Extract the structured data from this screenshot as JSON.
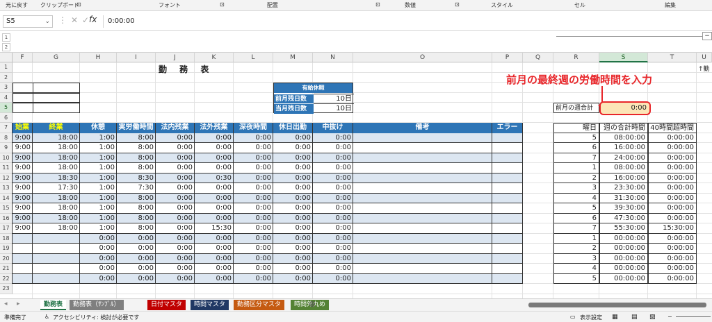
{
  "ribbon": {
    "groups": [
      "元に戻す",
      "クリップボード",
      "フォント",
      "配置",
      "数値",
      "スタイル",
      "セル",
      "編集"
    ],
    "launcher_icon": "dialog-launcher-icon"
  },
  "formula_bar": {
    "name_box": "S5",
    "formula": "0:00:00",
    "fx_label": "fx"
  },
  "outline_levels": [
    "1",
    "2"
  ],
  "columns": [
    "F",
    "G",
    "H",
    "I",
    "J",
    "K",
    "L",
    "M",
    "N",
    "O",
    "P",
    "Q",
    "R",
    "S",
    "T",
    "U"
  ],
  "selected_column": "S",
  "rows": [
    "1",
    "2",
    "3",
    "4",
    "5",
    "6",
    "7",
    "8",
    "9",
    "10",
    "11",
    "12",
    "13",
    "14",
    "15",
    "16",
    "17",
    "18",
    "19",
    "20",
    "21",
    "22",
    "23"
  ],
  "selected_row": "5",
  "title": "勤 務 表",
  "note_right": "↑勤",
  "paid_leave": {
    "title": "有給休暇",
    "rows": [
      {
        "label": "前月残日数",
        "value": "10日"
      },
      {
        "label": "当月残日数",
        "value": "10日"
      }
    ]
  },
  "annotation": "前月の最終週の労働時間を入力",
  "prev_week_label": "前月の週合計",
  "prev_week_value": "0:00",
  "table_headers": [
    "始業",
    "終業",
    "休憩",
    "実労働時間",
    "法内残業",
    "法外残業",
    "深夜時間",
    "休日出勤",
    "中抜け",
    "備考",
    "エラー"
  ],
  "table_rows": [
    [
      "9:00",
      "18:00",
      "1:00",
      "8:00",
      "0:00",
      "0:00",
      "0:00",
      "0:00",
      "0:00"
    ],
    [
      "9:00",
      "18:00",
      "1:00",
      "8:00",
      "0:00",
      "0:00",
      "0:00",
      "0:00",
      "0:00"
    ],
    [
      "9:00",
      "18:00",
      "1:00",
      "8:00",
      "0:00",
      "0:00",
      "0:00",
      "0:00",
      "0:00"
    ],
    [
      "9:00",
      "18:00",
      "1:00",
      "8:00",
      "0:00",
      "0:00",
      "0:00",
      "0:00",
      "0:00"
    ],
    [
      "9:00",
      "18:30",
      "1:00",
      "8:30",
      "0:00",
      "0:30",
      "0:00",
      "0:00",
      "0:00"
    ],
    [
      "9:00",
      "17:30",
      "1:00",
      "7:30",
      "0:00",
      "0:00",
      "0:00",
      "0:00",
      "0:00"
    ],
    [
      "9:00",
      "18:00",
      "1:00",
      "8:00",
      "0:00",
      "0:00",
      "0:00",
      "0:00",
      "0:00"
    ],
    [
      "9:00",
      "18:00",
      "1:00",
      "8:00",
      "0:00",
      "0:00",
      "0:00",
      "0:00",
      "0:00"
    ],
    [
      "9:00",
      "18:00",
      "1:00",
      "8:00",
      "0:00",
      "0:00",
      "0:00",
      "0:00",
      "0:00"
    ],
    [
      "9:00",
      "18:00",
      "1:00",
      "8:00",
      "0:00",
      "15:30",
      "0:00",
      "0:00",
      "0:00"
    ],
    [
      "",
      "",
      "0:00",
      "0:00",
      "0:00",
      "0:00",
      "0:00",
      "0:00",
      "0:00"
    ],
    [
      "",
      "",
      "0:00",
      "0:00",
      "0:00",
      "0:00",
      "0:00",
      "0:00",
      "0:00"
    ],
    [
      "",
      "",
      "0:00",
      "0:00",
      "0:00",
      "0:00",
      "0:00",
      "0:00",
      "0:00"
    ],
    [
      "",
      "",
      "0:00",
      "0:00",
      "0:00",
      "0:00",
      "0:00",
      "0:00",
      "0:00"
    ],
    [
      "",
      "",
      "0:00",
      "0:00",
      "0:00",
      "0:00",
      "0:00",
      "0:00",
      "0:00"
    ]
  ],
  "week_headers": [
    "曜日",
    "週の合計時間",
    "40時間超時間"
  ],
  "week_rows": [
    [
      "5",
      "08:00:00",
      "0:00:00"
    ],
    [
      "6",
      "16:00:00",
      "0:00:00"
    ],
    [
      "7",
      "24:00:00",
      "0:00:00"
    ],
    [
      "1",
      "08:00:00",
      "0:00:00"
    ],
    [
      "2",
      "16:00:00",
      "0:00:00"
    ],
    [
      "3",
      "23:30:00",
      "0:00:00"
    ],
    [
      "4",
      "31:30:00",
      "0:00:00"
    ],
    [
      "5",
      "39:30:00",
      "0:00:00"
    ],
    [
      "6",
      "47:30:00",
      "0:00:00"
    ],
    [
      "7",
      "55:30:00",
      "15:30:00"
    ],
    [
      "1",
      "00:00:00",
      "0:00:00"
    ],
    [
      "2",
      "00:00:00",
      "0:00:00"
    ],
    [
      "3",
      "00:00:00",
      "0:00:00"
    ],
    [
      "4",
      "00:00:00",
      "0:00:00"
    ],
    [
      "5",
      "00:00:00",
      "0:00:00"
    ]
  ],
  "sheet_tabs": [
    {
      "label": "勤務表",
      "color": "#ffffff",
      "text": "#217346"
    },
    {
      "label": "勤務表（ｻﾝﾌﾟﾙ）",
      "color": "#7f7f7f",
      "text": "#ffffff"
    },
    {
      "label": "日付マスタ",
      "color": "#c00000",
      "text": "#ffffff"
    },
    {
      "label": "時間マスタ",
      "color": "#203864",
      "text": "#ffffff"
    },
    {
      "label": "勤務区分マスタ",
      "color": "#c55a11",
      "text": "#ffffff"
    },
    {
      "label": "時間外丸め",
      "color": "#548235",
      "text": "#ffffff"
    }
  ],
  "add_sheet": "⊕",
  "status": {
    "ready": "準備完了",
    "accessibility": "アクセシビリティ: 検討が必要です",
    "display_settings": "表示設定"
  },
  "colors": {
    "accent": "#2e75b6",
    "highlight": "#e8262a",
    "yellow_text": "#ffff00"
  }
}
